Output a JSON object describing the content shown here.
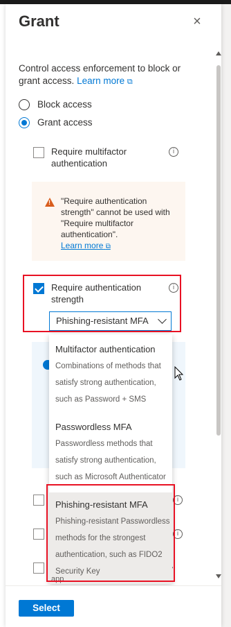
{
  "panel": {
    "title": "Grant",
    "close_icon": "×",
    "description": "Control access enforcement to block or grant access.",
    "learn_more": "Learn more"
  },
  "access": {
    "block_label": "Block access",
    "grant_label": "Grant access",
    "selected": "Grant access"
  },
  "controls": {
    "mfa_label_1": "Require multifactor",
    "mfa_label_2": "authentication",
    "warning_text": "\"Require authentication strength\" cannot be used with \"Require multifactor authentication\".",
    "warning_link": "Learn more",
    "strength_label_1": "Require authentication",
    "strength_label_2": "strength",
    "dropdown_value": "Phishing-resistant MFA"
  },
  "menu": {
    "items": [
      {
        "title": "Multifactor authentication",
        "lines": [
          "Combinations of methods that",
          "satisfy strong authentication,",
          "such as Password + SMS"
        ]
      },
      {
        "title": "Passwordless MFA",
        "lines": [
          "Passwordless methods that",
          "satisfy strong authentication,",
          "such as Microsoft Authenticator"
        ]
      },
      {
        "title": "Phishing-resistant MFA",
        "lines": [
          "Phishing-resistant Passwordless",
          "methods for the strongest",
          "authentication, such as FIDO2",
          "Security Key"
        ]
      }
    ]
  },
  "partial": {
    "app_text": "app"
  },
  "footer": {
    "select_label": "Select"
  },
  "colors": {
    "accent": "#0078d4",
    "highlight": "#e81123",
    "warning": "#d85c1c"
  }
}
